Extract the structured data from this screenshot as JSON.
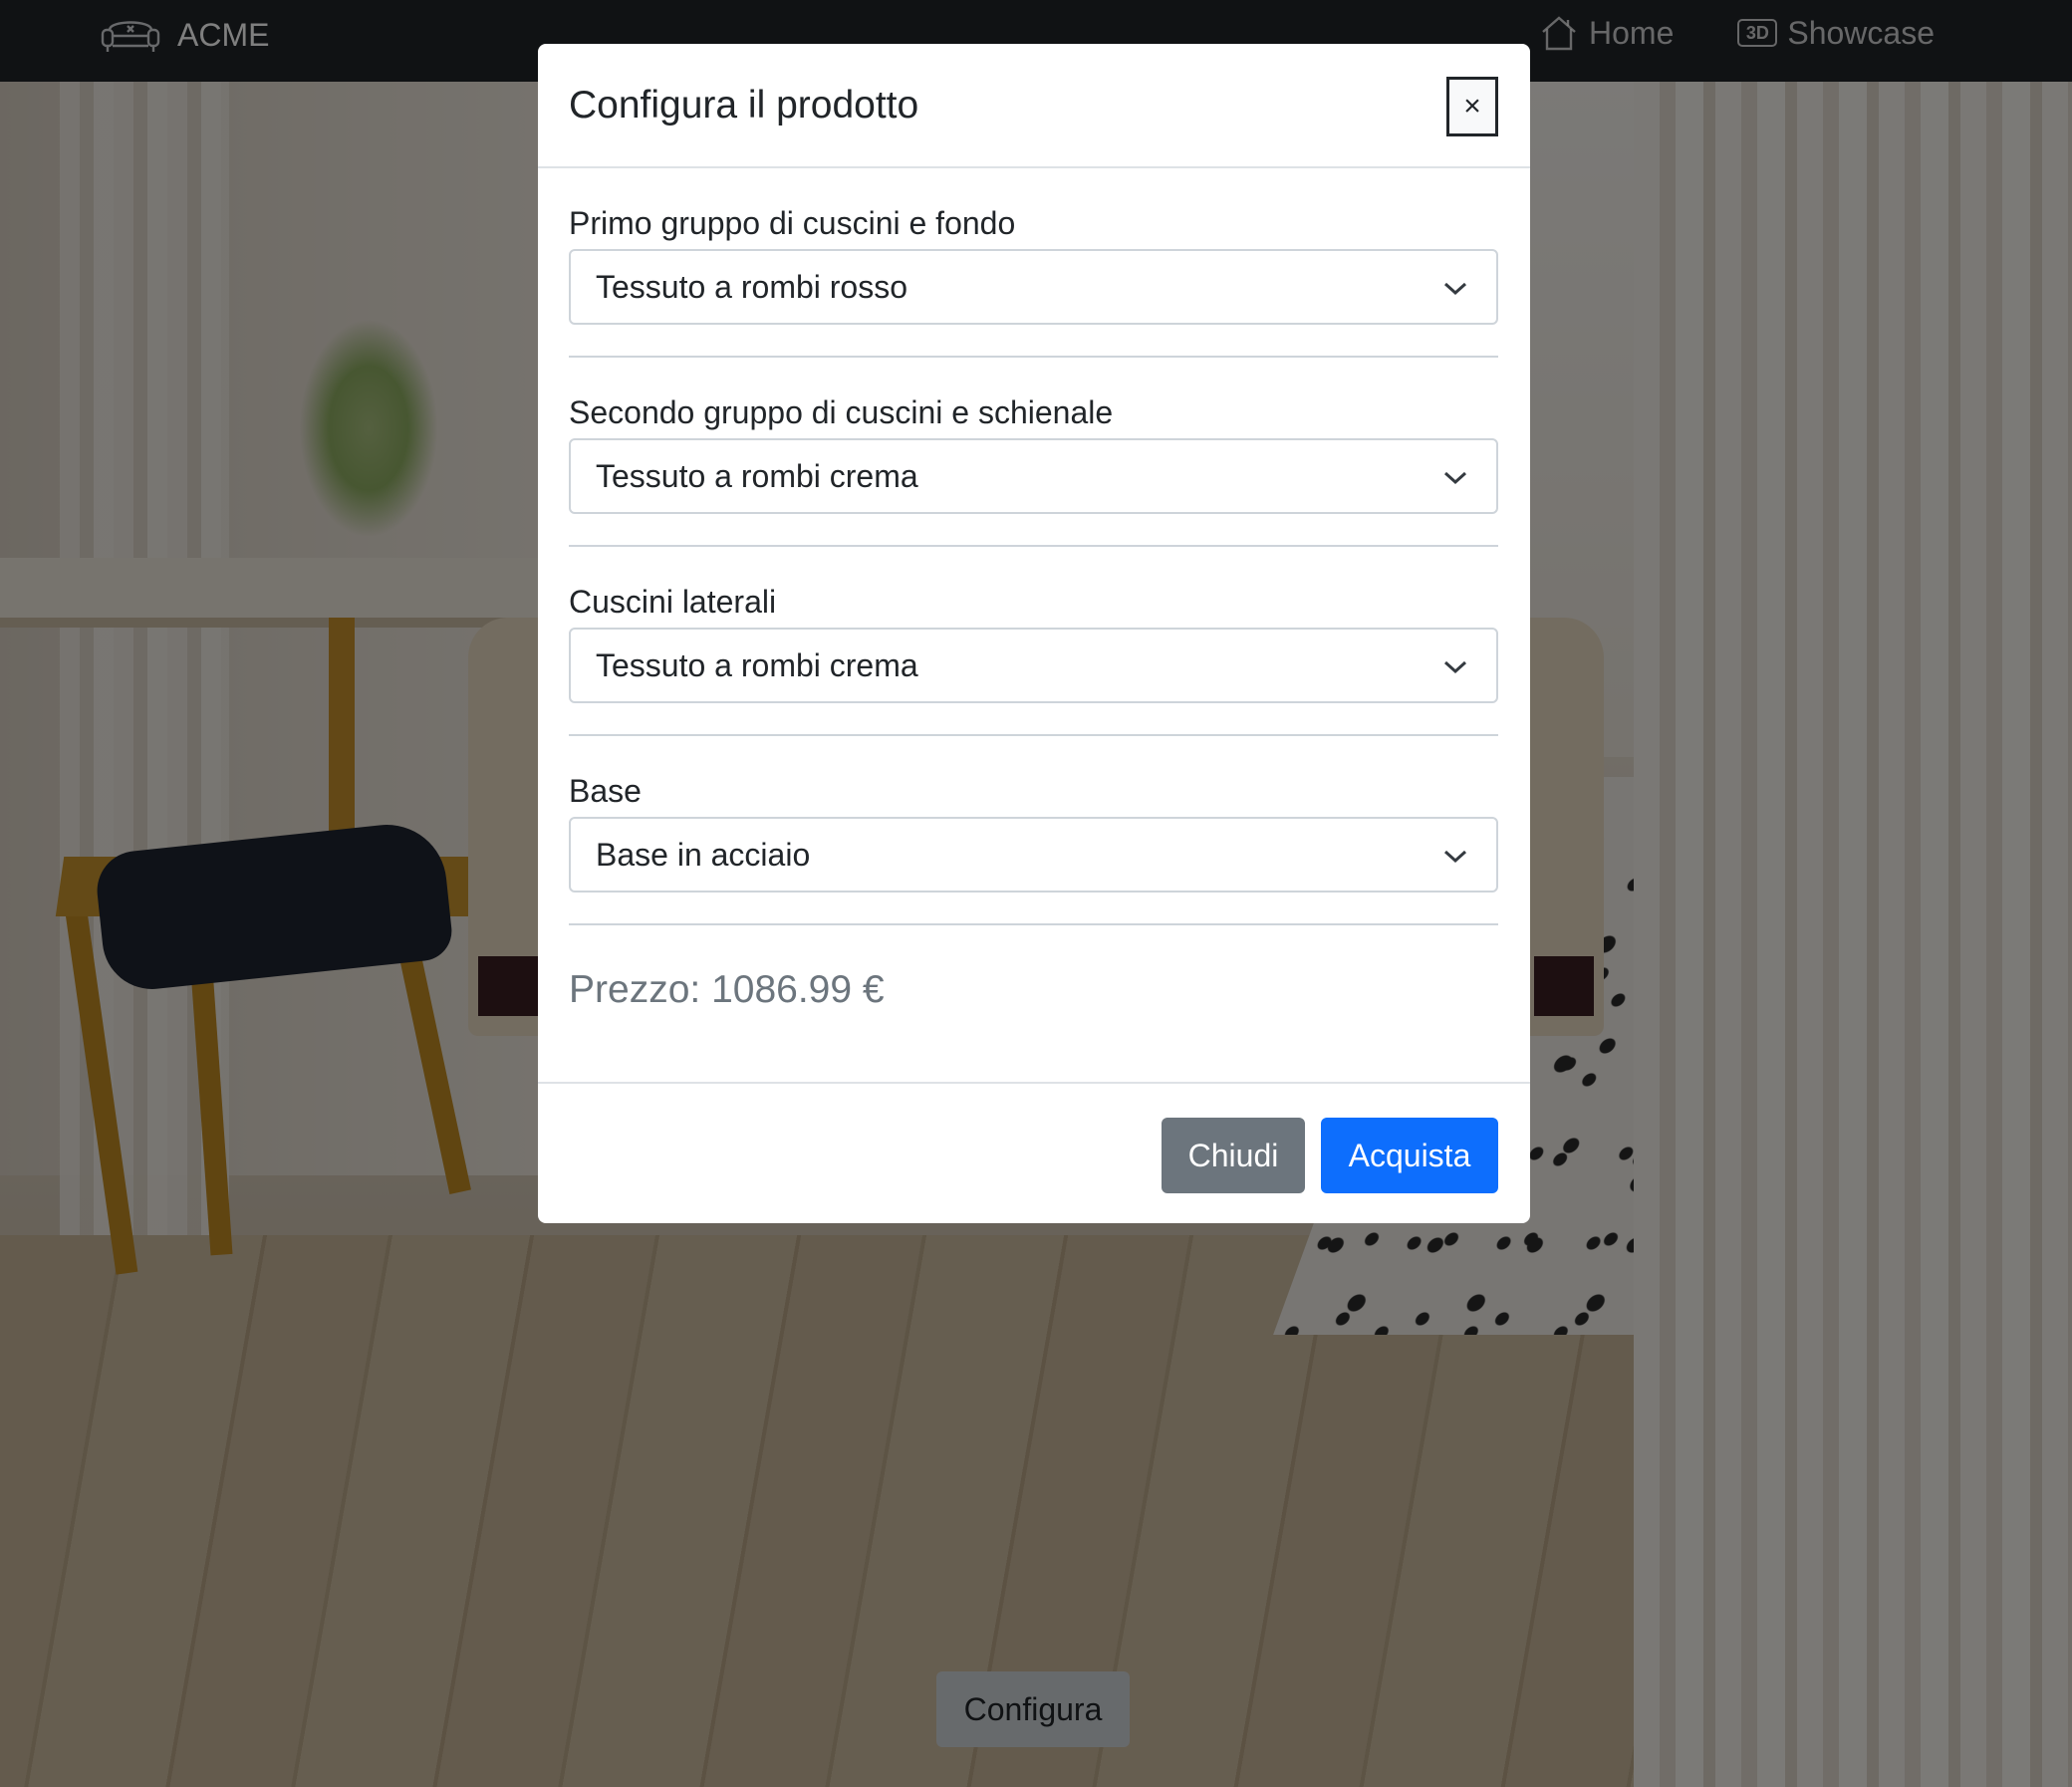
{
  "navbar": {
    "brand_icon": "sofa-icon",
    "brand_label": "ACME",
    "links": [
      {
        "label": "Home",
        "icon": "house-icon"
      },
      {
        "label": "Showcase",
        "icon": "3d-icon",
        "icon_text": "3D"
      }
    ]
  },
  "configure_button_label": "Configura",
  "modal": {
    "title": "Configura il prodotto",
    "close_label": "×",
    "fields": [
      {
        "label": "Primo gruppo di cuscini e fondo",
        "value": "Tessuto a rombi rosso"
      },
      {
        "label": "Secondo gruppo di cuscini e schienale",
        "value": "Tessuto a rombi crema"
      },
      {
        "label": "Cuscini laterali",
        "value": "Tessuto a rombi crema"
      },
      {
        "label": "Base",
        "value": "Base in acciaio"
      }
    ],
    "price_label": "Prezzo:",
    "price_value": "1086.99 €",
    "buttons": {
      "close": "Chiudi",
      "buy": "Acquista"
    }
  },
  "colors": {
    "navbar_bg": "#212529",
    "primary": "#0d6efd",
    "secondary": "#6c757d",
    "backdrop": "rgba(0,0,0,0.5)"
  }
}
